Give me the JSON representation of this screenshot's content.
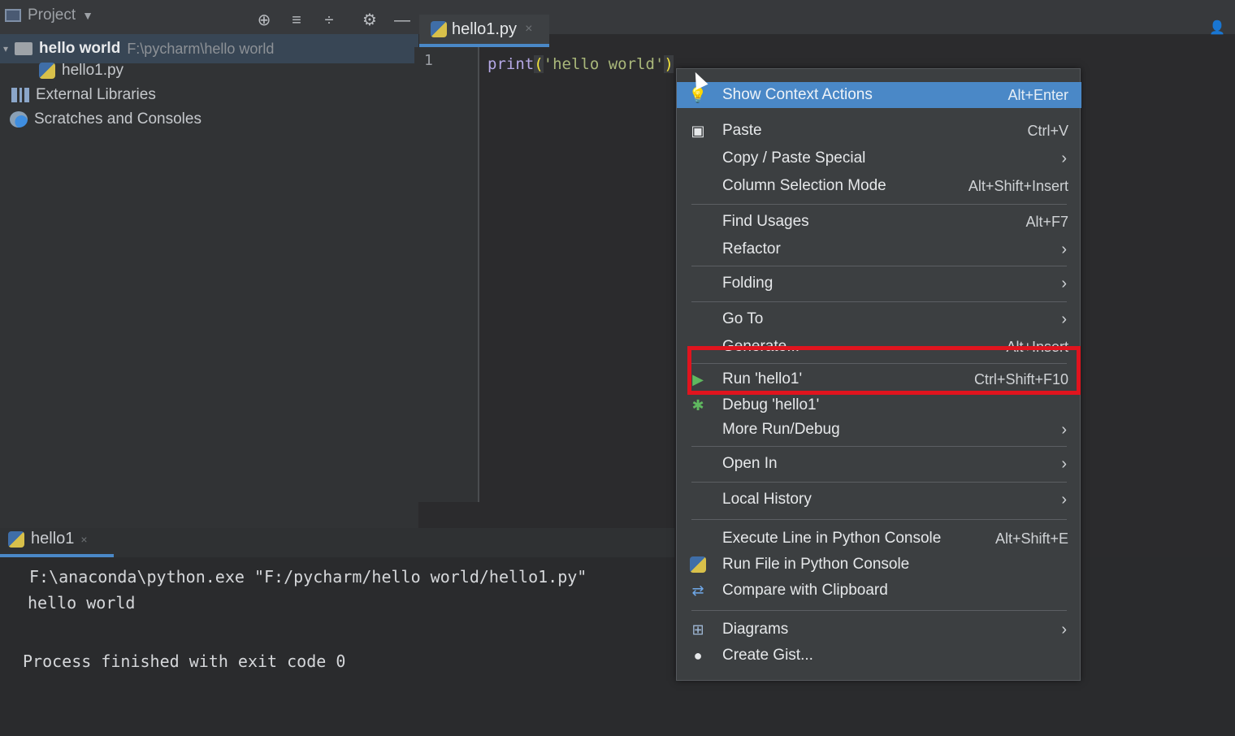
{
  "window": {
    "project_label": "Project",
    "editor_tab": "hello1.py"
  },
  "tree": {
    "root_name": "hello world",
    "root_path": "F:\\pycharm\\hello world",
    "file": "hello1.py",
    "external_libraries": "External Libraries",
    "scratches": "Scratches and Consoles"
  },
  "editor": {
    "line_number": "1",
    "code_keyword": "print",
    "code_open": "(",
    "code_string": "'hello world'",
    "code_close": ")"
  },
  "run": {
    "tab_label": "hello1",
    "console_lines": [
      "F:\\anaconda\\python.exe \"F:/pycharm/hello world/hello1.py\"",
      "hello world",
      "",
      "Process finished with exit code 0"
    ]
  },
  "context_menu": {
    "items": [
      {
        "label": "Show Context Actions",
        "shortcut": "Alt+Enter",
        "icon": "lightbulb-icon",
        "highlighted": true
      },
      {
        "label": "Paste",
        "shortcut": "Ctrl+V",
        "icon": "paste-icon"
      },
      {
        "label": "Copy / Paste Special",
        "submenu": true
      },
      {
        "label": "Column Selection Mode",
        "shortcut": "Alt+Shift+Insert"
      },
      {
        "label": "Find Usages",
        "shortcut": "Alt+F7"
      },
      {
        "label": "Refactor",
        "submenu": true
      },
      {
        "label": "Folding",
        "submenu": true
      },
      {
        "label": "Go To",
        "submenu": true
      },
      {
        "label": "Generate...",
        "shortcut": "Alt+Insert"
      },
      {
        "label": "Run 'hello1'",
        "shortcut": "Ctrl+Shift+F10",
        "icon": "run-icon"
      },
      {
        "label": "Debug 'hello1'",
        "icon": "debug-icon"
      },
      {
        "label": "More Run/Debug",
        "submenu": true
      },
      {
        "label": "Open In",
        "submenu": true
      },
      {
        "label": "Local History",
        "submenu": true
      },
      {
        "label": "Execute Line in Python Console",
        "shortcut": "Alt+Shift+E"
      },
      {
        "label": "Run File in Python Console",
        "icon": "python-console-icon"
      },
      {
        "label": "Compare with Clipboard",
        "icon": "compare-icon"
      },
      {
        "label": "Diagrams",
        "submenu": true,
        "icon": "diagrams-icon"
      },
      {
        "label": "Create Gist...",
        "icon": "github-icon"
      }
    ]
  },
  "colors": {
    "highlight_box": "#e0141e",
    "selection": "#4a88c7"
  }
}
